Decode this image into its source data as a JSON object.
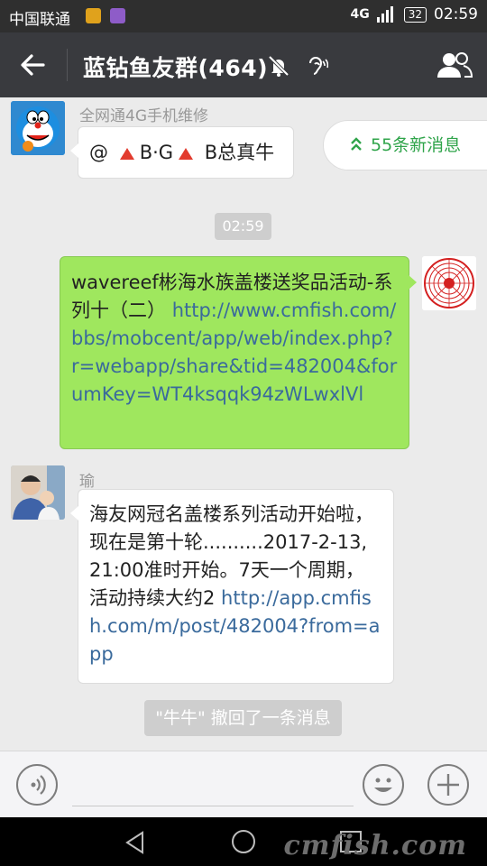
{
  "status_bar": {
    "carrier": "中国联通",
    "network": "4G",
    "battery": "32",
    "time": "02:59"
  },
  "header": {
    "title": "蓝钻鱼友群(464)"
  },
  "new_messages_badge": "55条新消息",
  "messages": [
    {
      "sender": "全网通4G手机维修",
      "parts": [
        "@",
        "B·G",
        "B总真牛"
      ]
    },
    {
      "time": "02:59"
    },
    {
      "text": "wavereef彬海水族盖楼送奖品活动-系列十（二）",
      "link": "http://www.cmfish.com/bbs/mobcent/app/web/index.php?r=webapp/share&tid=482004&forumKey=WT4ksqqk94zWLwxlVl"
    },
    {
      "sender": "瑜",
      "text": "海友网冠名盖楼系列活动开始啦，现在是第十轮..........2017-2-13, 21:00准时开始。7天一个周期，活动持续大约2 ",
      "link": "http://app.cmfish.com/m/post/482004?from=app"
    }
  ],
  "recall_notice": "\"牛牛\" 撤回了一条消息",
  "watermark": "cmfish.com",
  "colors": {
    "nav_bg": "#393a3e",
    "sent_bubble": "#9fe75e",
    "link": "#3a6a9c",
    "new_msg_green": "#2fa44a"
  }
}
